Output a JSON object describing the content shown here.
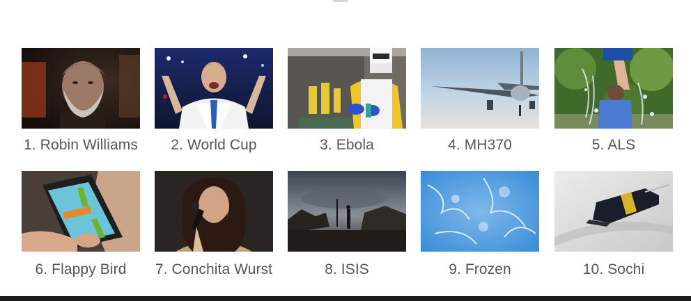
{
  "trends": {
    "items": [
      {
        "rank": "1.",
        "label": "Robin Williams",
        "caption": "1. Robin Williams",
        "icon": "portrait-photo"
      },
      {
        "rank": "2.",
        "label": "World Cup",
        "caption": "2. World Cup",
        "icon": "football-player-photo"
      },
      {
        "rank": "3.",
        "label": "Ebola",
        "caption": "3. Ebola",
        "icon": "health-worker-photo"
      },
      {
        "rank": "4.",
        "label": "MH370",
        "caption": "4. MH370",
        "icon": "airplane-photo"
      },
      {
        "rank": "5.",
        "label": "ALS",
        "caption": "5. ALS",
        "icon": "ice-bucket-photo"
      },
      {
        "rank": "6.",
        "label": "Flappy Bird",
        "caption": "6. Flappy Bird",
        "icon": "phone-game-photo"
      },
      {
        "rank": "7.",
        "label": "Conchita Wurst",
        "caption": "7. Conchita Wurst",
        "icon": "singer-photo"
      },
      {
        "rank": "8.",
        "label": "ISIS",
        "caption": "8. ISIS",
        "icon": "ruins-photo"
      },
      {
        "rank": "9.",
        "label": "Frozen",
        "caption": "9. Frozen",
        "icon": "frost-photo"
      },
      {
        "rank": "10.",
        "label": "Sochi",
        "caption": "10. Sochi",
        "icon": "bobsled-photo"
      }
    ]
  },
  "colors": {
    "caption": "#555555",
    "background": "#ffffff",
    "bottom_bar": "#1b1b1b"
  }
}
